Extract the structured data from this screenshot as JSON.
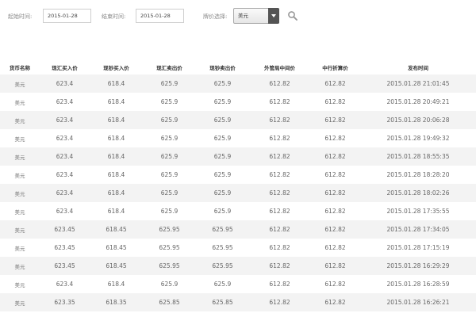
{
  "filters": {
    "start_label": "起始时间:",
    "start_value": "2015-01-28",
    "end_label": "结束时间:",
    "end_value": "2015-01-28",
    "currency_label": "牌价选择:",
    "currency_value": "美元",
    "search_icon": "search-icon"
  },
  "table": {
    "headers": [
      "货币名称",
      "现汇买入价",
      "现钞买入价",
      "现汇卖出价",
      "现钞卖出价",
      "外管局中间价",
      "中行折算价",
      "发布时间"
    ],
    "rows": [
      [
        "美元",
        "623.4",
        "618.4",
        "625.9",
        "625.9",
        "612.82",
        "612.82",
        "2015.01.28 21:01:45"
      ],
      [
        "美元",
        "623.4",
        "618.4",
        "625.9",
        "625.9",
        "612.82",
        "612.82",
        "2015.01.28 20:49:21"
      ],
      [
        "美元",
        "623.4",
        "618.4",
        "625.9",
        "625.9",
        "612.82",
        "612.82",
        "2015.01.28 20:06:28"
      ],
      [
        "美元",
        "623.4",
        "618.4",
        "625.9",
        "625.9",
        "612.82",
        "612.82",
        "2015.01.28 19:49:32"
      ],
      [
        "美元",
        "623.4",
        "618.4",
        "625.9",
        "625.9",
        "612.82",
        "612.82",
        "2015.01.28 18:55:35"
      ],
      [
        "美元",
        "623.4",
        "618.4",
        "625.9",
        "625.9",
        "612.82",
        "612.82",
        "2015.01.28 18:28:20"
      ],
      [
        "美元",
        "623.4",
        "618.4",
        "625.9",
        "625.9",
        "612.82",
        "612.82",
        "2015.01.28 18:02:26"
      ],
      [
        "美元",
        "623.4",
        "618.4",
        "625.9",
        "625.9",
        "612.82",
        "612.82",
        "2015.01.28 17:35:55"
      ],
      [
        "美元",
        "623.45",
        "618.45",
        "625.95",
        "625.95",
        "612.82",
        "612.82",
        "2015.01.28 17:34:05"
      ],
      [
        "美元",
        "623.45",
        "618.45",
        "625.95",
        "625.95",
        "612.82",
        "612.82",
        "2015.01.28 17:15:19"
      ],
      [
        "美元",
        "623.45",
        "618.45",
        "625.95",
        "625.95",
        "612.82",
        "612.82",
        "2015.01.28 16:29:29"
      ],
      [
        "美元",
        "623.4",
        "618.4",
        "625.9",
        "625.9",
        "612.82",
        "612.82",
        "2015.01.28 16:28:59"
      ],
      [
        "美元",
        "623.35",
        "618.35",
        "625.85",
        "625.85",
        "612.82",
        "612.82",
        "2015.01.28 16:26:21"
      ]
    ]
  }
}
